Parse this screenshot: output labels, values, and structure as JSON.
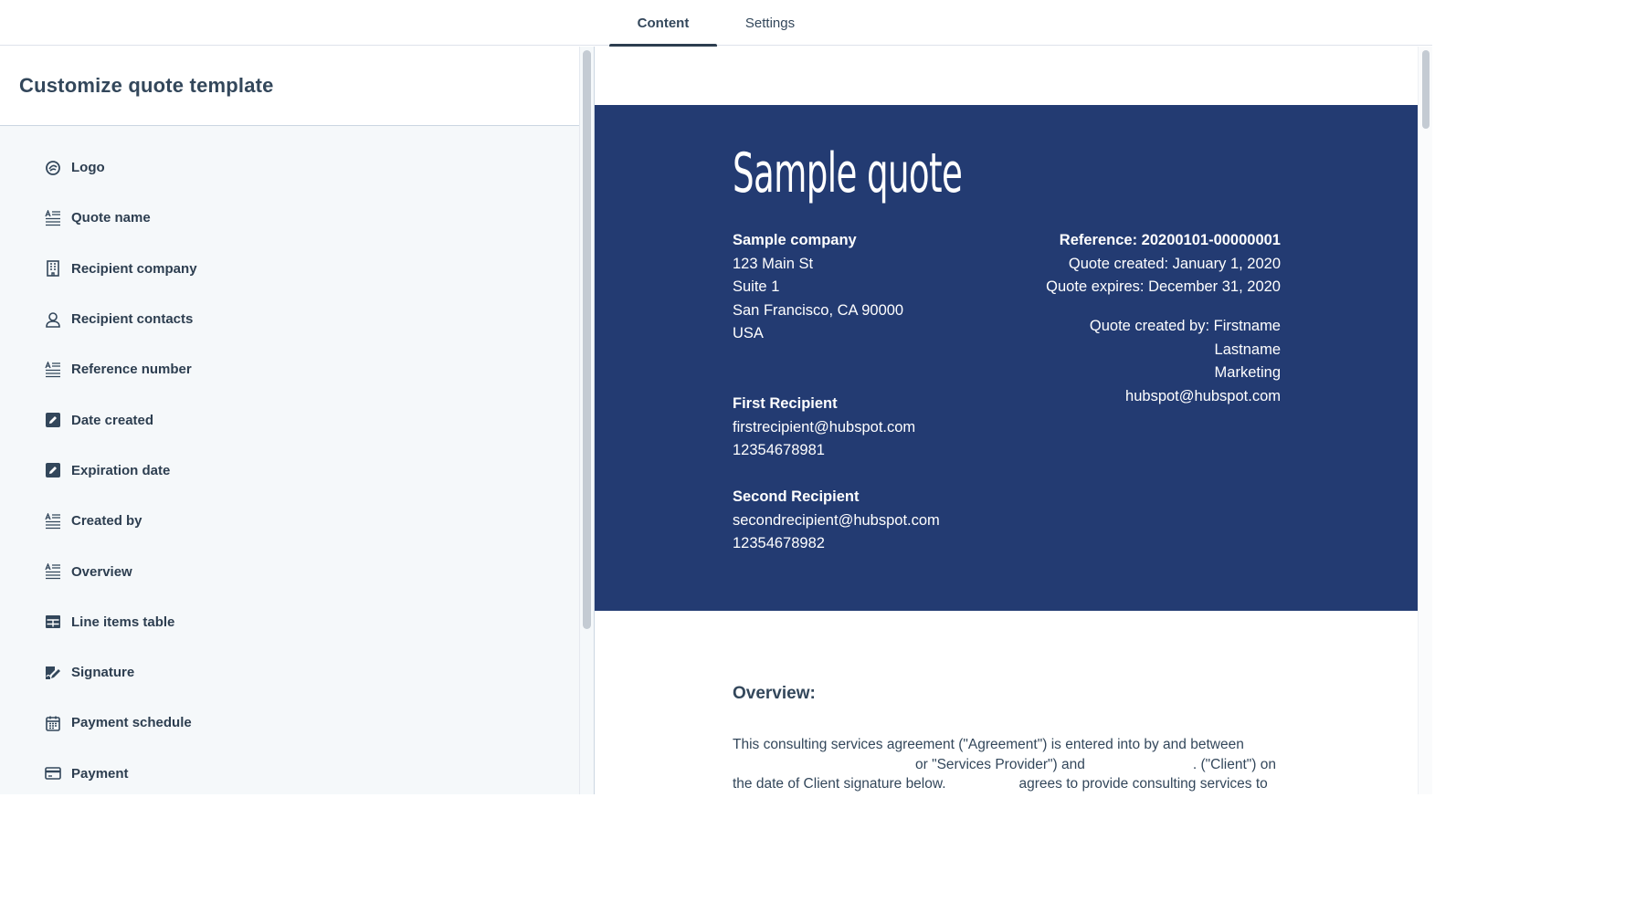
{
  "tabs": [
    {
      "label": "Content",
      "active": true
    },
    {
      "label": "Settings",
      "active": false
    }
  ],
  "sidebar": {
    "title": "Customize quote template",
    "items": [
      {
        "label": "Logo",
        "icon": "logo-icon"
      },
      {
        "label": "Quote name",
        "icon": "text-block-icon"
      },
      {
        "label": "Recipient company",
        "icon": "building-icon"
      },
      {
        "label": "Recipient contacts",
        "icon": "contact-icon"
      },
      {
        "label": "Reference number",
        "icon": "text-block-icon"
      },
      {
        "label": "Date created",
        "icon": "edit-icon"
      },
      {
        "label": "Expiration date",
        "icon": "edit-icon"
      },
      {
        "label": "Created by",
        "icon": "text-block-icon"
      },
      {
        "label": "Overview",
        "icon": "text-block-icon"
      },
      {
        "label": "Line items table",
        "icon": "table-icon"
      },
      {
        "label": "Signature",
        "icon": "signature-icon"
      },
      {
        "label": "Payment schedule",
        "icon": "calendar-icon"
      },
      {
        "label": "Payment",
        "icon": "credit-card-icon"
      }
    ]
  },
  "preview": {
    "title": "Sample quote",
    "company": {
      "name": "Sample company",
      "address1": "123 Main St",
      "address2": "Suite 1",
      "city": "San Francisco, CA 90000",
      "country": "USA"
    },
    "reference": "Reference: 20200101-00000001",
    "created": "Quote created: January 1, 2020",
    "expires": "Quote expires: December 31, 2020",
    "created_by": {
      "line1": "Quote created by: Firstname",
      "line2": "Lastname",
      "line3": "Marketing",
      "email": "hubspot@hubspot.com"
    },
    "recipients": [
      {
        "name": "First Recipient",
        "email": "firstrecipient@hubspot.com",
        "phone": "12354678981"
      },
      {
        "name": "Second Recipient",
        "email": "secondrecipient@hubspot.com",
        "phone": "12354678982"
      }
    ],
    "overview_heading": "Overview:",
    "overview_lines": [
      "This consulting services agreement (\"Agreement\") is entered into by and between",
      "or \"Services Provider\") and",
      ". (\"Client\") on",
      "the date of Client signature below.",
      "agrees to provide consulting services to"
    ]
  },
  "colors": {
    "hero_background": "#233b72",
    "panel_background": "#f5f8fa",
    "text": "#33475b"
  }
}
